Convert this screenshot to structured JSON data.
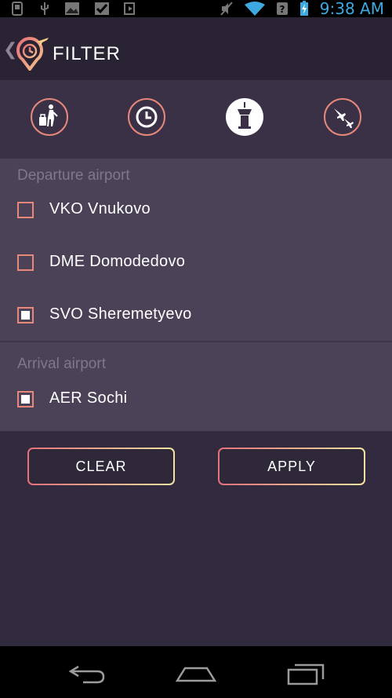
{
  "status_bar": {
    "time": "9:38 AM",
    "icons": [
      "phone-icon",
      "usb-icon",
      "image-icon",
      "checkbox-icon",
      "play-store-icon",
      "mute-icon",
      "wifi-icon",
      "no-sim-icon",
      "battery-charging-icon"
    ]
  },
  "action_bar": {
    "title": "FILTER",
    "up_icon": "back-chevron-icon",
    "logo_icon": "flight-time-logo-icon"
  },
  "tabs": [
    {
      "name": "traveler",
      "icon": "person-luggage-icon",
      "selected": false
    },
    {
      "name": "time",
      "icon": "clock-icon",
      "selected": false
    },
    {
      "name": "airport",
      "icon": "control-tower-icon",
      "selected": true
    },
    {
      "name": "airlines",
      "icon": "planes-icon",
      "selected": false
    }
  ],
  "departure": {
    "title": "Departure airport",
    "items": [
      {
        "label": "VKO Vnukovo",
        "checked": false
      },
      {
        "label": "DME Domodedovo",
        "checked": false
      },
      {
        "label": "SVO Sheremetyevo",
        "checked": true
      }
    ]
  },
  "arrival": {
    "title": "Arrival airport",
    "items": [
      {
        "label": "AER Sochi",
        "checked": true
      }
    ]
  },
  "buttons": {
    "clear_label": "CLEAR",
    "apply_label": "APPLY"
  },
  "nav": {
    "back_icon": "back-icon",
    "home_icon": "home-icon",
    "recents_icon": "recents-icon"
  },
  "colors": {
    "accent_from": "#e8707a",
    "accent_to": "#f4e4a0",
    "clock": "#3ea9e0",
    "background": "#322a3e",
    "panel": "#4b4257"
  }
}
